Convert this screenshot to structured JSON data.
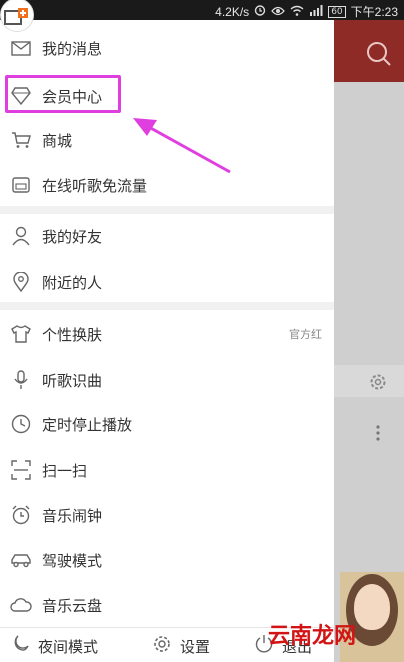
{
  "status_bar": {
    "speed": "4.2K/s",
    "battery": "60",
    "time": "下午2:23"
  },
  "menu": {
    "group1": [
      {
        "label": "我的消息",
        "icon": "mail-icon"
      },
      {
        "label": "会员中心",
        "icon": "vip-diamond-icon"
      },
      {
        "label": "商城",
        "icon": "cart-icon"
      },
      {
        "label": "在线听歌免流量",
        "icon": "sim-card-icon"
      }
    ],
    "group2": [
      {
        "label": "我的好友",
        "icon": "person-icon"
      },
      {
        "label": "附近的人",
        "icon": "location-pin-icon"
      }
    ],
    "group3": [
      {
        "label": "个性换肤",
        "icon": "tshirt-icon",
        "value": "官方红"
      },
      {
        "label": "听歌识曲",
        "icon": "microphone-icon"
      },
      {
        "label": "定时停止播放",
        "icon": "clock-icon"
      },
      {
        "label": "扫一扫",
        "icon": "scan-icon"
      },
      {
        "label": "音乐闹钟",
        "icon": "alarm-clock-icon"
      },
      {
        "label": "驾驶模式",
        "icon": "car-icon"
      },
      {
        "label": "音乐云盘",
        "icon": "cloud-icon"
      }
    ]
  },
  "footer": {
    "night_mode": "夜间模式",
    "settings": "设置",
    "logout": "退出"
  },
  "watermark": "云南龙网",
  "colors": {
    "highlight": "#e03fe0",
    "header_red": "#8e2b26",
    "watermark": "#d21414"
  }
}
